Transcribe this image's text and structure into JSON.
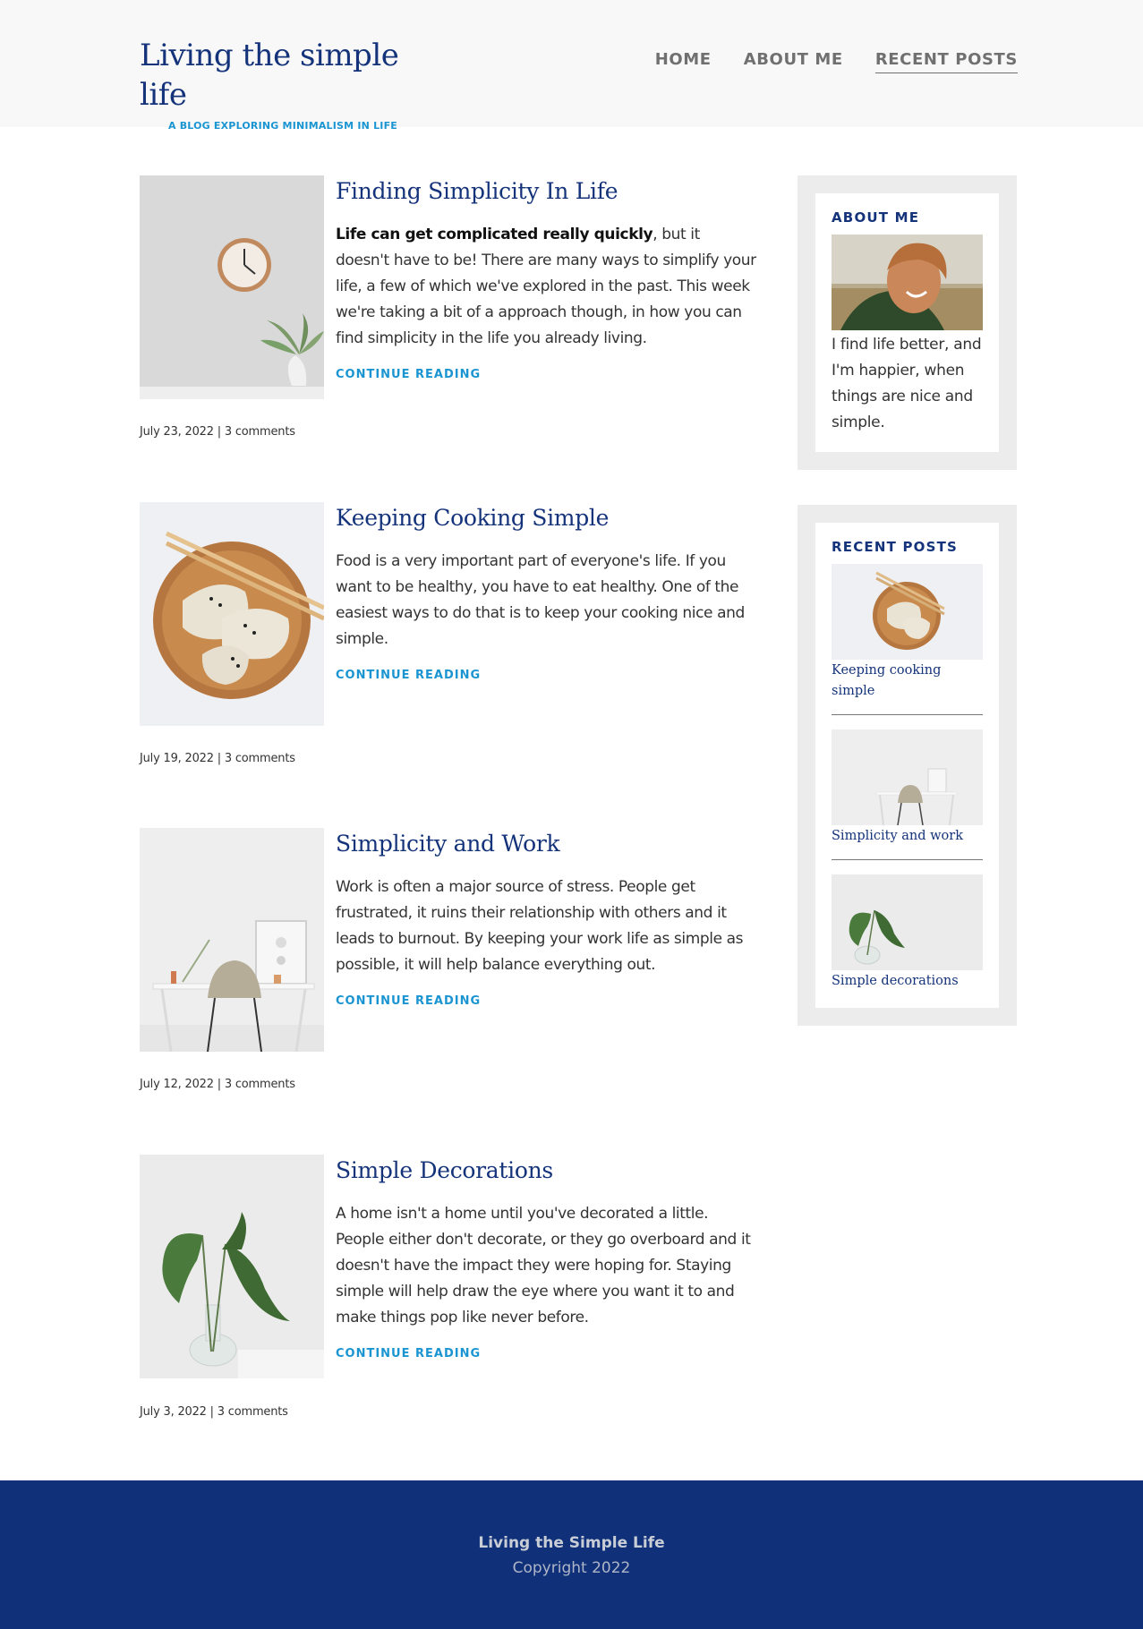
{
  "header": {
    "site_title": "Living the simple life",
    "tagline": "A BLOG EXPLORING MINIMALISM IN LIFE",
    "nav": [
      {
        "label": "HOME"
      },
      {
        "label": "ABOUT ME"
      },
      {
        "label": "RECENT POSTS",
        "active": true
      }
    ]
  },
  "posts": [
    {
      "title": "Finding Simplicity In Life",
      "excerpt_bold": "Life can get complicated really quickly",
      "excerpt": ", but it doesn't have to be! There are many ways to simplify your life, a few of which we've explored in the past. This week we're taking a bit of a approach though, in how you can find simplicity in the life you already living.",
      "cta": "CONTINUE READING",
      "meta": "July 23, 2022 | 3 comments",
      "image": "clock-and-plant-image"
    },
    {
      "title": "Keeping Cooking Simple",
      "excerpt": "Food is a very important part of everyone's life. If you want to be healthy, you have to eat healthy. One of the easiest ways to do that is to keep your cooking nice and simple.",
      "cta": "CONTINUE READING",
      "meta": "July 19, 2022 | 3 comments",
      "image": "dumplings-bowl-image"
    },
    {
      "title": "Simplicity and Work",
      "excerpt": "Work is often a major source of stress. People get frustrated, it ruins their relationship with others and it leads to burnout. By keeping your work life as simple as possible, it will help balance everything out.",
      "cta": "CONTINUE READING",
      "meta": "July 12, 2022 | 3 comments",
      "image": "desk-and-chair-image"
    },
    {
      "title": "Simple Decorations",
      "excerpt": "A home isn't a home until you've decorated a little. People either don't decorate, or they go overboard and it doesn't have the impact they were hoping for. Staying simple will help draw the eye where you want it to and make things pop like never before.",
      "cta": "CONTINUE READING",
      "meta": "July 3, 2022 | 3 comments",
      "image": "plant-in-vase-image"
    }
  ],
  "sidebar": {
    "about": {
      "title": "ABOUT ME",
      "text": "I find life better, and I'm happier, when things are nice and simple.",
      "image": "smiling-man-photo"
    },
    "recent": {
      "title": "RECENT POSTS",
      "items": [
        {
          "label": "Keeping cooking simple"
        },
        {
          "label": "Simplicity and work"
        },
        {
          "label": "Simple decorations"
        }
      ]
    }
  },
  "footer": {
    "title": "Living the Simple Life",
    "copyright": "Copyright 2022"
  },
  "colors": {
    "brand_navy": "#14337a",
    "accent_blue": "#1a95d2",
    "header_bg": "#f8f8f8",
    "footer_bg": "#10317a",
    "widget_bg": "#ececec"
  }
}
